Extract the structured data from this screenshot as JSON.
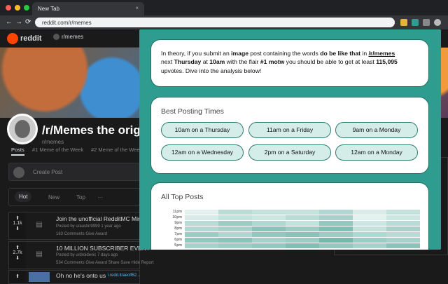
{
  "browser": {
    "tab_title": "New Tab",
    "tab_close": "×",
    "url": "reddit.com/r/memes",
    "back_icon": "←",
    "forward_icon": "→",
    "reload_icon": "⟳",
    "dot_colors": [
      "#ff5f57",
      "#febc2e",
      "#28c840"
    ]
  },
  "reddit": {
    "logo_text": "reddit",
    "subreddit": "r/memes",
    "sub_title": "/r/Memes the original",
    "sub_handle": "r/memes",
    "subtabs": [
      "Posts",
      "#1 Meme of the Week",
      "#2 Meme of the Week"
    ],
    "create_post_placeholder": "Create Post",
    "sort": [
      "Hot",
      "New",
      "Top",
      "···"
    ],
    "posts": [
      {
        "votes": "1.1k",
        "title": "Join the unofficial RedditMC Min",
        "meta": "Posted by u/austin9999 1 year ago",
        "actions": "163 Comments   Give Award"
      },
      {
        "votes": "2.7k",
        "title": "10 MILLION SUBSCRIBER EVENT",
        "meta": "Posted by u/droidevic 7 days ago",
        "actions": "534 Comments   Give Award   Share   Save   Hide   Report"
      },
      {
        "votes": "",
        "title": "Oh no he's onto us",
        "link": "i.redd.it/aeolf62...",
        "meta": "",
        "actions": ""
      }
    ]
  },
  "analysis": {
    "intro": {
      "p1": "In theory, if you submit an ",
      "b1": "image",
      "p2": " post containing the words ",
      "b2": "do be like that",
      "p3": " in ",
      "link": "/r/memes",
      "p4": "next ",
      "b3": "Thursday",
      "p5": " at ",
      "b4": "10am",
      "p6": " with the flair ",
      "b5": "#1 motw",
      "p7": " you should be able to get at least ",
      "b6": "115,095",
      "p8": "upvotes. Dive into the analysis below!"
    },
    "best_times_title": "Best Posting Times",
    "best_times": [
      "10am on a Thursday",
      "11am on a Friday",
      "9am on a Monday",
      "12am on a Wednesday",
      "2pm on a Saturday",
      "12am on a Monday"
    ],
    "all_top_title": "All Top Posts",
    "heat_labels": [
      "11pm",
      "10pm",
      "9pm",
      "8pm",
      "7pm",
      "6pm",
      "5pm"
    ],
    "heat_rows": [
      [
        0.15,
        0.35,
        0.3,
        0.3,
        0.4,
        0.2,
        0.3
      ],
      [
        0.2,
        0.3,
        0.25,
        0.35,
        0.45,
        0.15,
        0.25
      ],
      [
        0.35,
        0.5,
        0.4,
        0.3,
        0.55,
        0.25,
        0.35
      ],
      [
        0.4,
        0.45,
        0.6,
        0.5,
        0.65,
        0.3,
        0.45
      ],
      [
        0.5,
        0.4,
        0.55,
        0.6,
        0.5,
        0.4,
        0.35
      ],
      [
        0.55,
        0.6,
        0.45,
        0.5,
        0.7,
        0.5,
        0.45
      ],
      [
        0.45,
        0.5,
        0.55,
        0.65,
        0.55,
        0.45,
        0.6
      ]
    ],
    "colors": {
      "accent": "#2e9c8e",
      "heat": "#3a9b8c"
    }
  }
}
